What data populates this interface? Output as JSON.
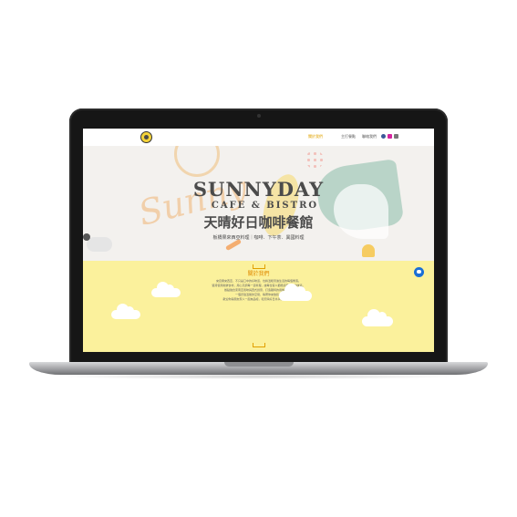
{
  "nav": {
    "items": [
      {
        "label": "關於我們",
        "active": true
      },
      {
        "label": "主打餐點",
        "active": false
      },
      {
        "label": "聯絡我們",
        "active": false
      }
    ],
    "social": [
      {
        "icon": "facebook-icon",
        "color": "#3b5998"
      },
      {
        "icon": "instagram-icon",
        "color": "#d6249f"
      },
      {
        "icon": "map-icon",
        "color": "#777777"
      }
    ]
  },
  "hero": {
    "title": "SUNNYDAY",
    "subtitle": "CAFE & BISTRO",
    "chinese_name": "天晴好日咖啡餐館",
    "tagline": "板橋果來西亞料理｜咖啡．下午茶．異國料理"
  },
  "about": {
    "title": "關於我們",
    "paragraph_lines": [
      "來自果來西亞，不只是口中的好味道，也將溫暖帶進生活的每個角落。",
      "堅持使用新鮮食材，用心烹調每一道料理，讓每位客人都能感受到家的味道。",
      "餐點融合東南亞風味與西式創意，打造獨特的用餐體驗。",
      "一個舒適溫馨的空間，等著你來放鬆。",
      "歡迎你與朋友家人一起來品嚐，和天晴好日共享美好時光。"
    ]
  },
  "colors": {
    "accent": "#e0a300",
    "about_bg": "#fbf19c",
    "chat": "#1a6fd6"
  }
}
